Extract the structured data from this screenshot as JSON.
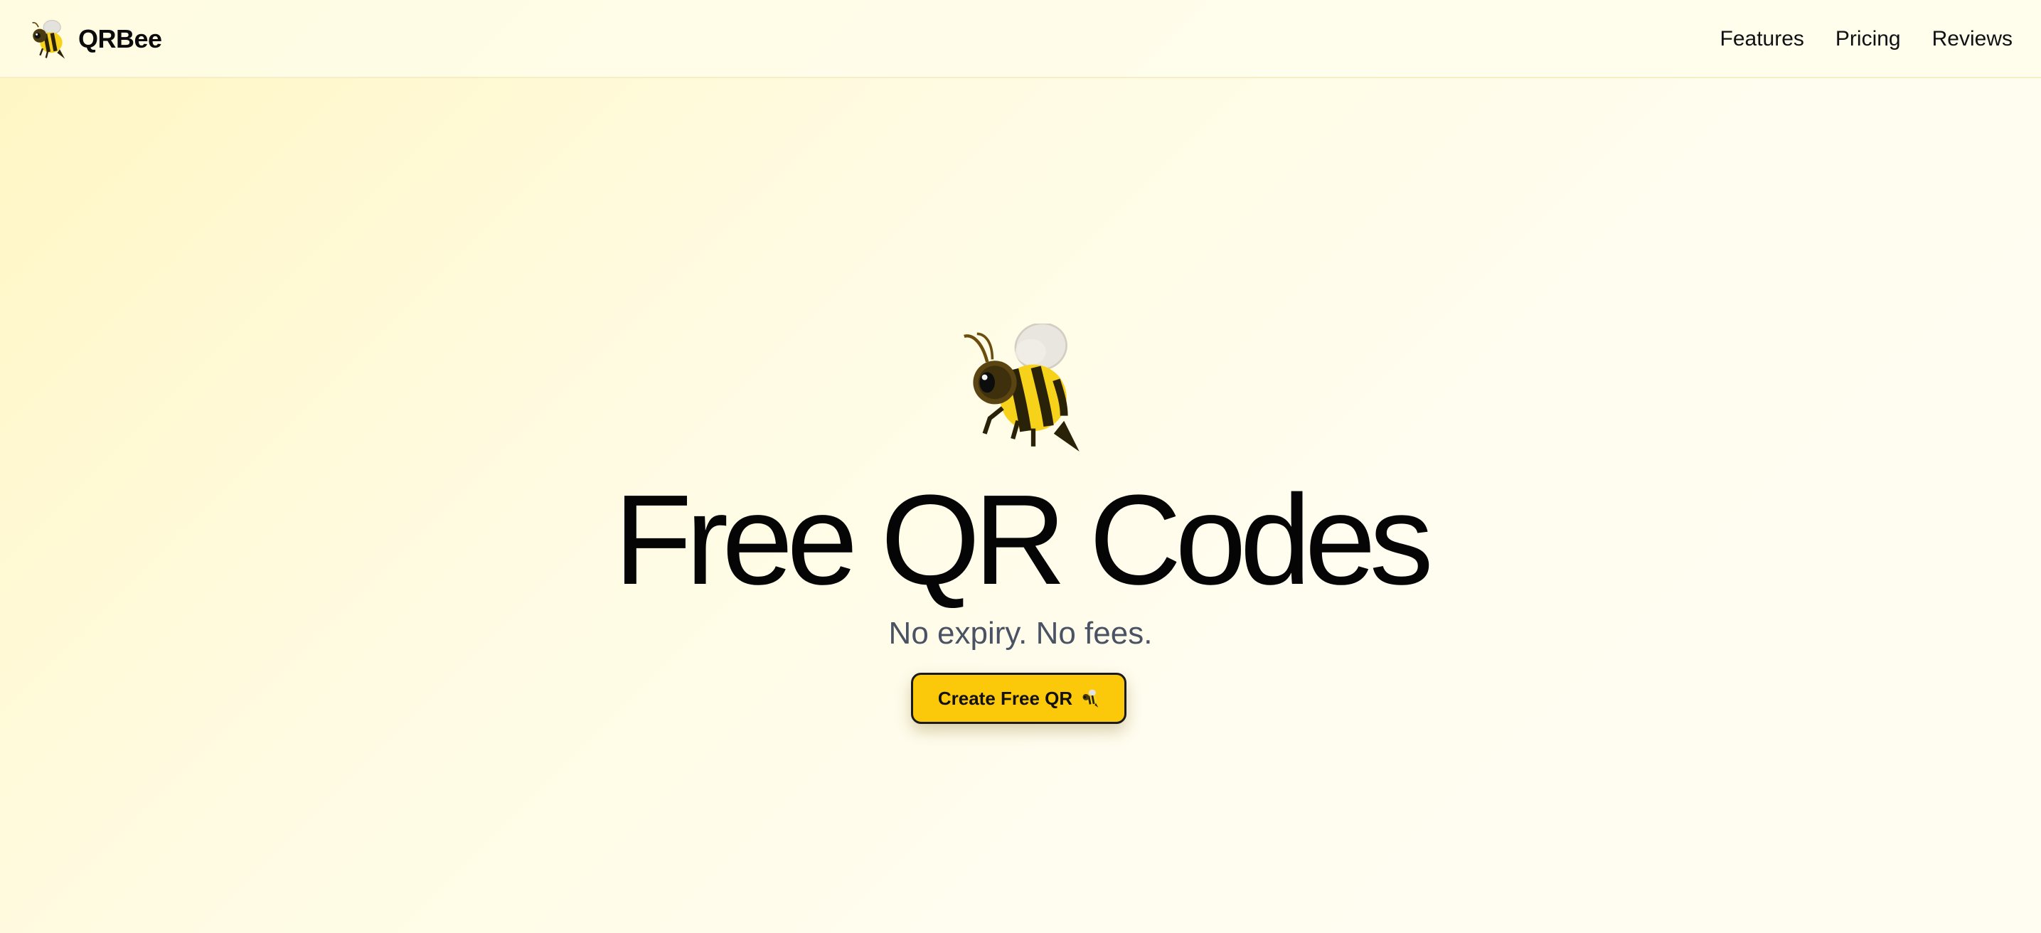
{
  "brand": {
    "name": "QRBee",
    "logo_icon": "bee-icon"
  },
  "nav": {
    "items": [
      {
        "label": "Features"
      },
      {
        "label": "Pricing"
      },
      {
        "label": "Reviews"
      }
    ]
  },
  "hero": {
    "icon": "bee-icon",
    "title": "Free QR Codes",
    "subtitle": "No expiry. No fees.",
    "cta_label": "Create Free QR",
    "cta_icon": "bee-icon"
  },
  "colors": {
    "accent": "#fcc80a",
    "background": "#fffbe2",
    "subtitle_text": "#4a5363"
  }
}
